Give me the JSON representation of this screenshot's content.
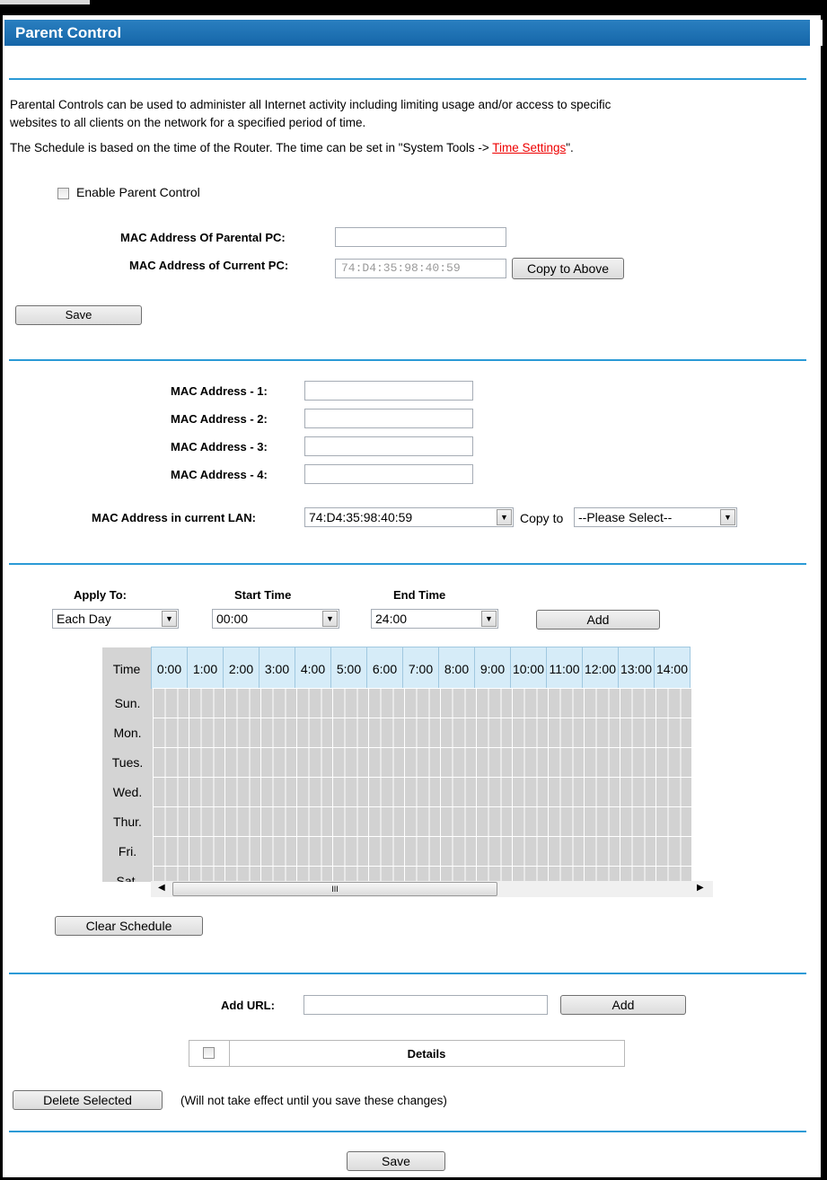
{
  "page": {
    "title": "Parent Control",
    "intro_line1": "Parental Controls can be used to administer all Internet activity including limiting usage and/or access to specific",
    "intro_line2": "websites to all clients on the network for a specified period of time.",
    "schedule_note_prefix": "The Schedule is based on the time of the Router. The time can be set in \"System Tools -> ",
    "schedule_note_link": "Time Settings",
    "schedule_note_suffix": "\"."
  },
  "parent_section": {
    "enable_label": "Enable Parent Control",
    "parental_pc_label": "MAC Address Of Parental PC:",
    "parental_pc_value": "",
    "current_pc_label": "MAC Address of Current PC:",
    "current_pc_value": "74:D4:35:98:40:59",
    "copy_button": "Copy to Above",
    "save_button": "Save"
  },
  "children_section": {
    "mac_labels": [
      "MAC Address - 1:",
      "MAC Address - 2:",
      "MAC Address - 3:",
      "MAC Address - 4:"
    ],
    "current_lan_label": "MAC Address in current LAN:",
    "current_lan_value": "74:D4:35:98:40:59",
    "copy_to_label": "Copy to",
    "copy_to_value": "--Please Select--"
  },
  "schedule": {
    "apply_to_label": "Apply To:",
    "apply_to_value": "Each Day",
    "start_time_label": "Start Time",
    "start_time_value": "00:00",
    "end_time_label": "End Time",
    "end_time_value": "24:00",
    "add_button": "Add",
    "time_header": "Time",
    "hours": [
      "0:00",
      "1:00",
      "2:00",
      "3:00",
      "4:00",
      "5:00",
      "6:00",
      "7:00",
      "8:00",
      "9:00",
      "10:00",
      "11:00",
      "12:00",
      "13:00",
      "14:00"
    ],
    "days": [
      "Sun.",
      "Mon.",
      "Tues.",
      "Wed.",
      "Thur.",
      "Fri.",
      "Sat."
    ],
    "scroll_glyph": "III",
    "clear_button": "Clear Schedule"
  },
  "url_section": {
    "add_url_label": "Add URL:",
    "add_url_value": "",
    "add_button": "Add",
    "details_header": "Details",
    "delete_button": "Delete Selected",
    "delete_note": "(Will not take effect until you save these changes)",
    "save_button": "Save"
  }
}
